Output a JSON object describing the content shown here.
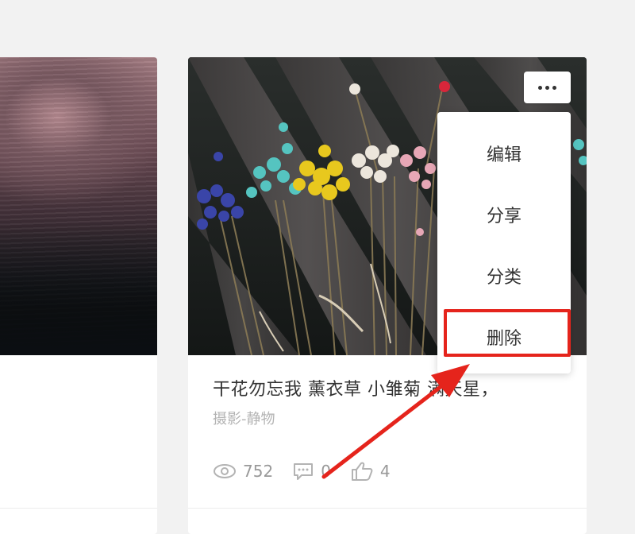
{
  "menu": {
    "more_button": "more-options",
    "items": [
      {
        "label": "编辑"
      },
      {
        "label": "分享"
      },
      {
        "label": "分类"
      },
      {
        "label": "删除"
      }
    ],
    "highlight_color": "#e5241c"
  },
  "card": {
    "title": "干花勿忘我 薰衣草 小雏菊 满天星，",
    "tag": "摄影-静物",
    "stats": {
      "views": "752",
      "comments": "0",
      "likes": "4"
    }
  },
  "icons": {
    "views": "eye-icon",
    "comments": "comment-icon",
    "likes": "thumbs-up-icon",
    "more": "more-horizontal-icon"
  }
}
